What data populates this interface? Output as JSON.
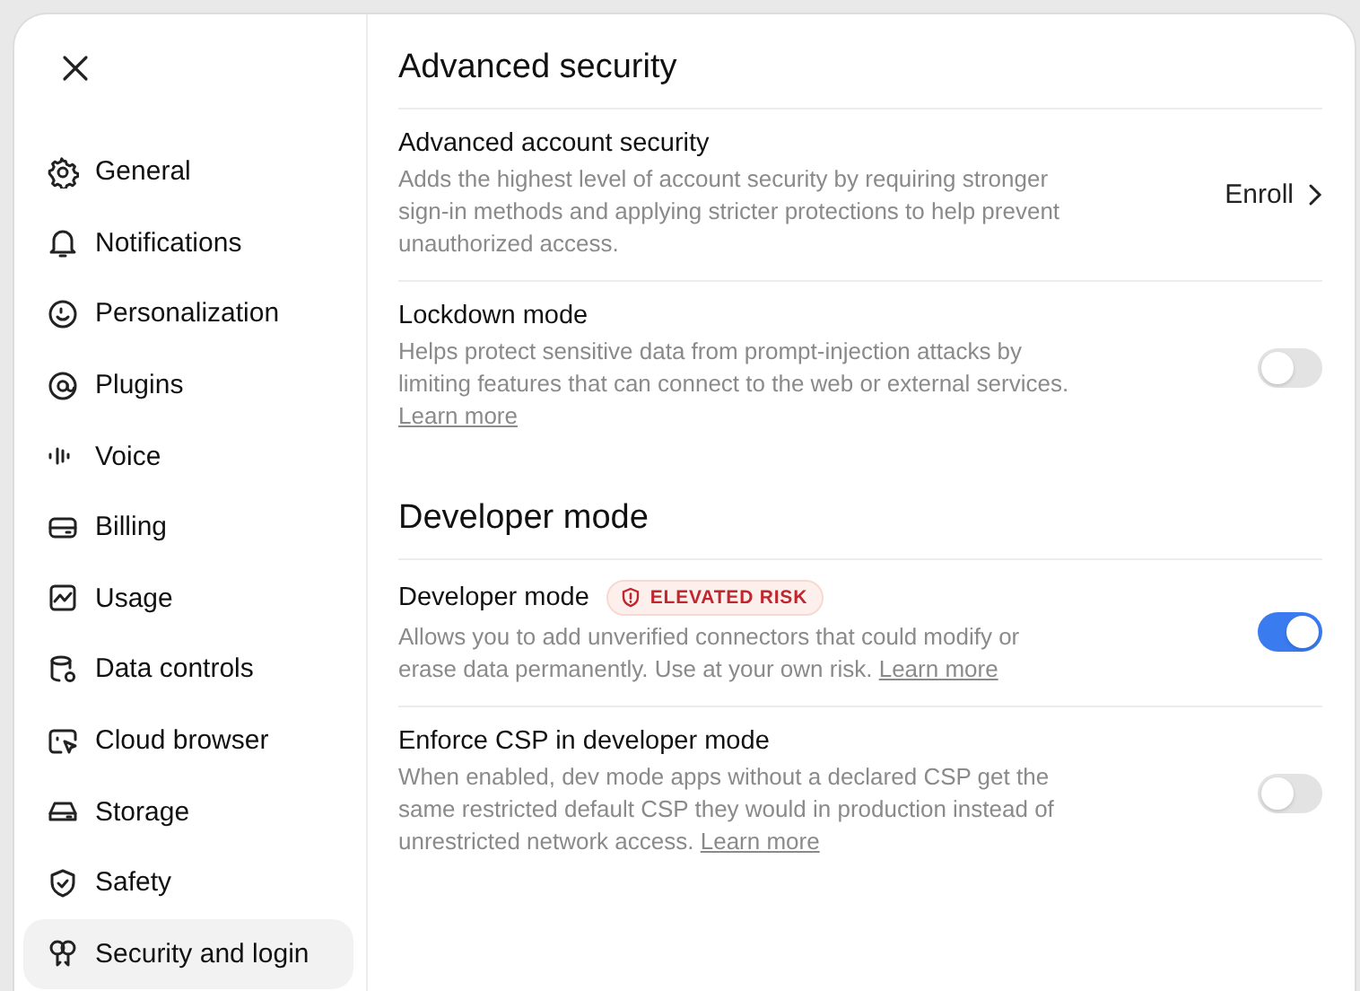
{
  "sidebar": {
    "items": [
      {
        "label": "General",
        "selected": false
      },
      {
        "label": "Notifications",
        "selected": false
      },
      {
        "label": "Personalization",
        "selected": false
      },
      {
        "label": "Plugins",
        "selected": false
      },
      {
        "label": "Voice",
        "selected": false
      },
      {
        "label": "Billing",
        "selected": false
      },
      {
        "label": "Usage",
        "selected": false
      },
      {
        "label": "Data controls",
        "selected": false
      },
      {
        "label": "Cloud browser",
        "selected": false
      },
      {
        "label": "Storage",
        "selected": false
      },
      {
        "label": "Safety",
        "selected": false
      },
      {
        "label": "Security and login",
        "selected": true
      }
    ]
  },
  "sections": [
    {
      "title": "Advanced security",
      "rows": [
        {
          "kind": "link",
          "title": "Advanced account security",
          "description": "Adds the highest level of account security by requiring stronger sign-in methods and applying stricter protections to help prevent unauthorized access.",
          "action": "Enroll"
        },
        {
          "kind": "toggle",
          "title": "Lockdown mode",
          "description": "Helps protect sensitive data from prompt-injection attacks by limiting features that can connect to the web or external services.",
          "link": "Learn more",
          "on": false
        }
      ]
    },
    {
      "title": "Developer mode",
      "rows": [
        {
          "kind": "toggle",
          "title": "Developer mode",
          "badge": "ELEVATED RISK",
          "description": "Allows you to add unverified connectors that could modify or erase data permanently. Use at your own risk.",
          "link": "Learn more",
          "on": true
        },
        {
          "kind": "toggle",
          "title": "Enforce CSP in developer mode",
          "description": "When enabled, dev mode apps without a declared CSP get the same restricted default CSP they would in production instead of unrestricted network access.",
          "link": "Learn more",
          "on": false
        }
      ]
    }
  ]
}
